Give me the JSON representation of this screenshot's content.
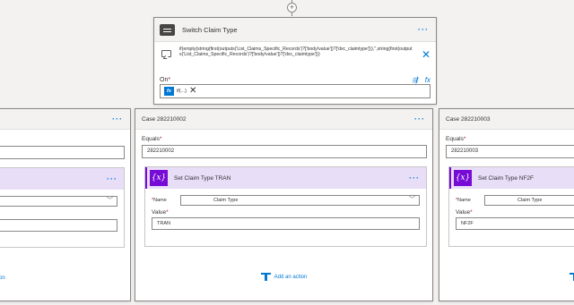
{
  "add_step_symbol": "+",
  "switch": {
    "title": "Switch Claim Type",
    "more": "···",
    "expression": "if(empty(string(first(outputs('List_Claims_Specific_Records')?['body/value'])?['dxc_claimtype'])),'',string(first(outputs('List_Claims_Specific_Records')?['body/value'])?['dxc_claimtype']))",
    "close": "✕",
    "on_label": "On",
    "required": "*",
    "fx_label": "fx",
    "token_text": "if(...)",
    "token_remove": "✕"
  },
  "cases": [
    {
      "title": "",
      "more": "···",
      "equals_label": "",
      "equals_value": "",
      "action_title": "",
      "action_more": "···",
      "name_label": "",
      "name_value": "",
      "value_label": "",
      "value_value": "",
      "add_action": "on"
    },
    {
      "title": "Case 282210002",
      "more": "···",
      "equals_label": "Equals",
      "equals_value": "282210002",
      "action_title": "Set Claim Type TRAN",
      "action_more": "···",
      "name_label": "Name",
      "name_value": "Claim Type",
      "value_label": "Value",
      "value_value": "TRAN",
      "add_action": "Add an action"
    },
    {
      "title": "Case 282210003",
      "more": "···",
      "equals_label": "Equals",
      "equals_value": "282210003",
      "action_title": "Set Claim Type NF2F",
      "action_more": "",
      "name_label": "Name",
      "name_value": "Claim Type",
      "value_label": "Value",
      "value_value": "NF2F",
      "add_action": ""
    }
  ],
  "var_icon": "{x}",
  "colors": {
    "accent": "#0078d4",
    "variable": "#770bd6",
    "required": "#a4262c"
  }
}
